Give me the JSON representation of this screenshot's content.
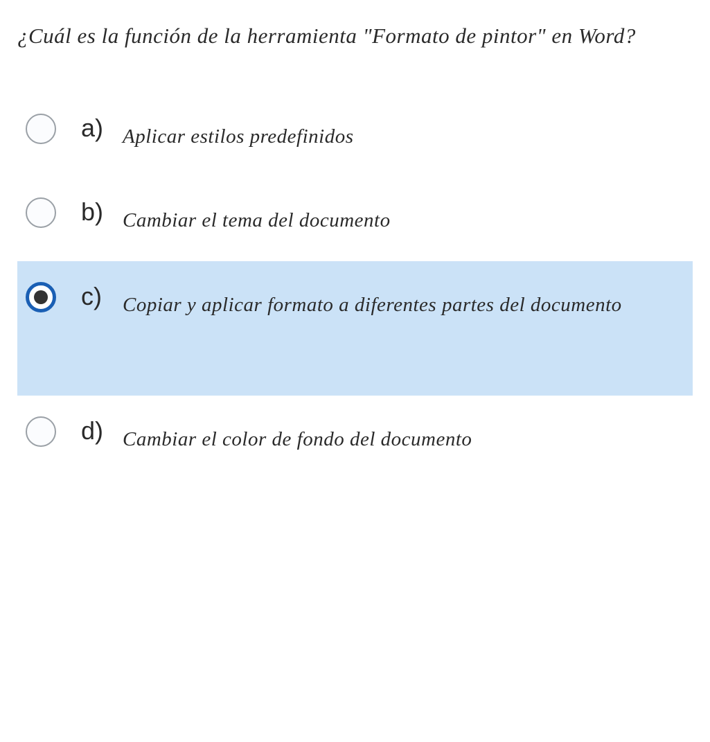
{
  "question": "¿Cuál es la función de la herramienta \"Formato de pintor\" en Word?",
  "options": [
    {
      "letter": "a)",
      "text": "Aplicar estilos predefinidos",
      "selected": false
    },
    {
      "letter": "b)",
      "text": "Cambiar el tema del documento",
      "selected": false
    },
    {
      "letter": "c)",
      "text": "Copiar y aplicar formato a diferentes partes del documento",
      "selected": true
    },
    {
      "letter": "d)",
      "text": "Cambiar el color de fondo del documento",
      "selected": false
    }
  ]
}
